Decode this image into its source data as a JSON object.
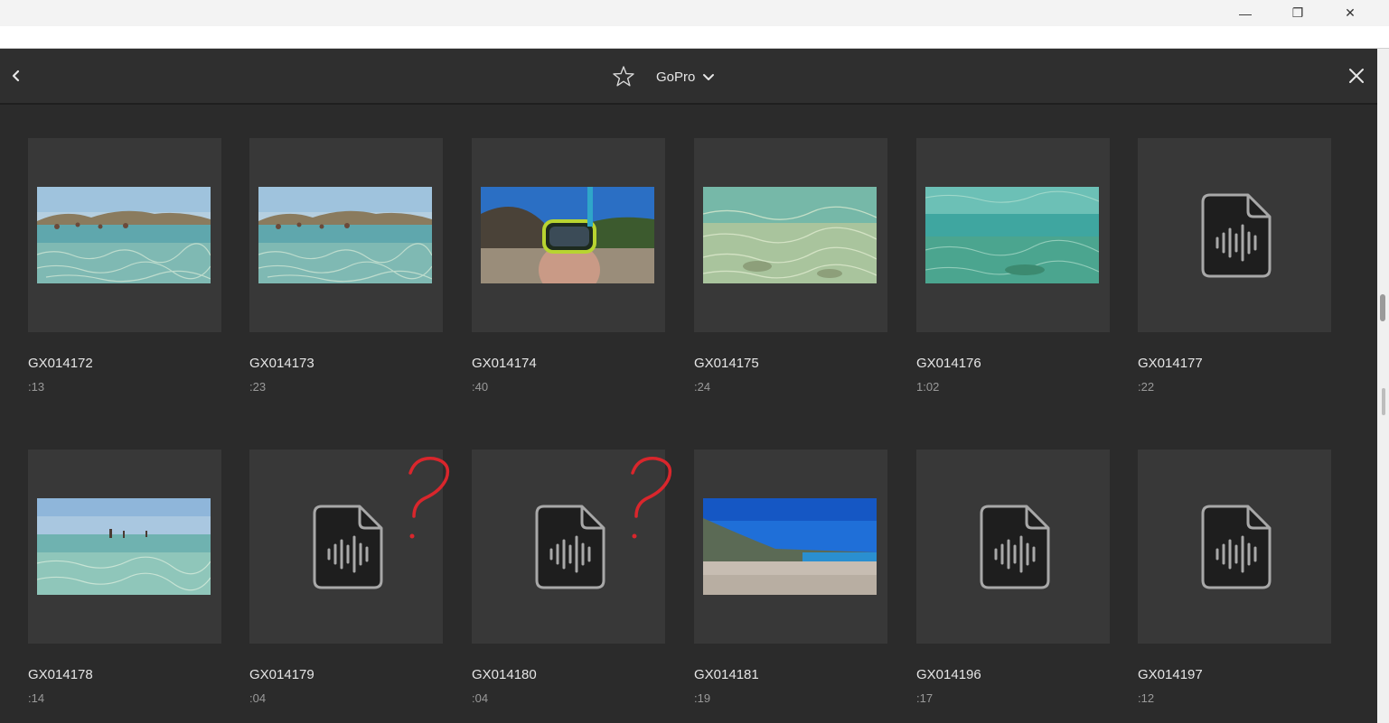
{
  "window": {
    "minimize_glyph": "—",
    "restore_glyph": "❐",
    "close_glyph": "✕"
  },
  "header": {
    "title": "GoPro",
    "back_icon": "chevron-left-icon",
    "favorite_icon": "star-outline-icon",
    "dropdown_icon": "chevron-down-icon",
    "close_icon": "close-icon"
  },
  "colors": {
    "background": "#2b2b2b",
    "tile_background": "#383838",
    "text_primary": "#e6e6e6",
    "text_secondary": "#9a9a9a",
    "annotation": "#d9262c"
  },
  "items": [
    {
      "name": "GX014172",
      "duration": ":13",
      "thumbnail": "photo",
      "scene": "beach-shallow-water-people"
    },
    {
      "name": "GX014173",
      "duration": ":23",
      "thumbnail": "photo",
      "scene": "beach-shallow-water-people"
    },
    {
      "name": "GX014174",
      "duration": ":40",
      "thumbnail": "photo",
      "scene": "selfie-snorkel-mask-beach"
    },
    {
      "name": "GX014175",
      "duration": ":24",
      "thumbnail": "photo",
      "scene": "underwater-sand"
    },
    {
      "name": "GX014176",
      "duration": "1:02",
      "thumbnail": "photo",
      "scene": "underwater-turquoise"
    },
    {
      "name": "GX014177",
      "duration": ":22",
      "thumbnail": "audio-file-icon"
    },
    {
      "name": "GX014178",
      "duration": ":14",
      "thumbnail": "photo",
      "scene": "shallow-water-distant-people"
    },
    {
      "name": "GX014179",
      "duration": ":04",
      "thumbnail": "audio-file-icon",
      "annotation": "?"
    },
    {
      "name": "GX014180",
      "duration": ":04",
      "thumbnail": "audio-file-icon",
      "annotation": "?"
    },
    {
      "name": "GX014181",
      "duration": ":19",
      "thumbnail": "photo",
      "scene": "pebble-beach-blue-sky"
    },
    {
      "name": "GX014196",
      "duration": ":17",
      "thumbnail": "audio-file-icon"
    },
    {
      "name": "GX014197",
      "duration": ":12",
      "thumbnail": "audio-file-icon"
    }
  ]
}
